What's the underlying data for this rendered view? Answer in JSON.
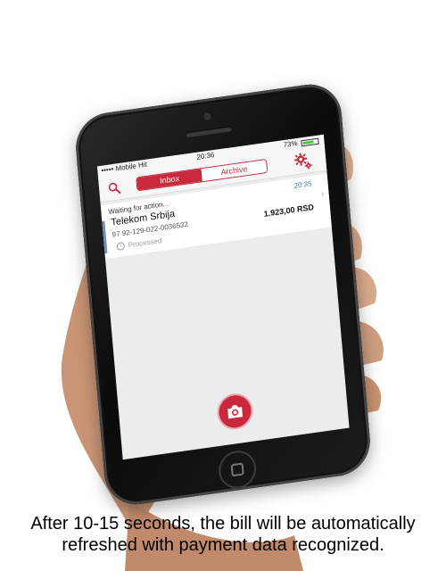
{
  "status_bar": {
    "carrier": "••••• Mobile Hit",
    "time": "20:36",
    "battery": "73%",
    "battery_level": 0.73
  },
  "nav": {
    "search_icon": "search-icon",
    "tabs": [
      {
        "label": "Inbox",
        "active": true
      },
      {
        "label": "Archive",
        "active": false
      }
    ],
    "settings_icon": "gear-icon"
  },
  "list": {
    "items": [
      {
        "status": "Waiting for action...",
        "time": "20:35",
        "title": "Telekom Srbija",
        "reference": "97 92-129-022-0036532",
        "amount": "1.923,00 RSD",
        "state": "Processed"
      }
    ]
  },
  "camera_button": {
    "icon": "camera-icon"
  },
  "caption": {
    "line1": "After 10-15 seconds, the bill will be automatically",
    "line2": "refreshed with payment data recognized."
  },
  "colors": {
    "accent": "#c9283d",
    "time_blue": "#4a78b5",
    "status_line": "#6c8ebf"
  }
}
